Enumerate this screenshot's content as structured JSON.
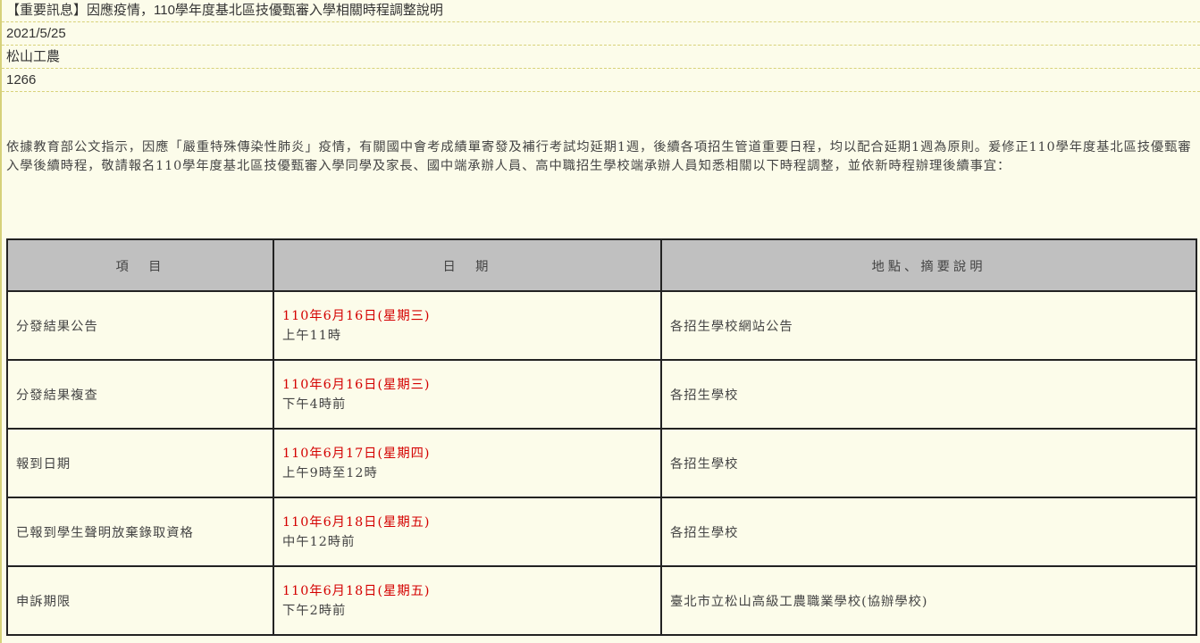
{
  "header": {
    "title": "【重要訊息】因應疫情，110學年度基北區技優甄審入學相關時程調整說明",
    "date": "2021/5/25",
    "publisher": "松山工農",
    "views": "1266"
  },
  "intro": "依據教育部公文指示，因應「嚴重特殊傳染性肺炎」疫情，有關國中會考成績單寄發及補行考試均延期1週，後續各項招生管道重要日程，均以配合延期1週為原則。爰修正110學年度基北區技優甄審入學後續時程，敬請報名110學年度基北區技優甄審入學同學及家長、國中端承辦人員、高中職招生學校端承辦人員知悉相關以下時程調整，並依新時程辦理後續事宜：",
  "table": {
    "headers": [
      "項　目",
      "日　期",
      "地點、摘要說明"
    ],
    "rows": [
      {
        "item": "分發結果公告",
        "date": "110年6月16日(星期三)",
        "time": "上午11時",
        "note": "各招生學校網站公告"
      },
      {
        "item": "分發結果複查",
        "date": "110年6月16日(星期三)",
        "time": "下午4時前",
        "note": "各招生學校"
      },
      {
        "item": "報到日期",
        "date": "110年6月17日(星期四)",
        "time": "上午9時至12時",
        "note": "各招生學校"
      },
      {
        "item": "已報到學生聲明放棄錄取資格",
        "date": "110年6月18日(星期五)",
        "time": "中午12時前",
        "note": "各招生學校"
      },
      {
        "item": "申訴期限",
        "date": "110年6月18日(星期五)",
        "time": "下午2時前",
        "note": "臺北市立松山高級工農職業學校(協辦學校)"
      }
    ]
  },
  "colors": {
    "background": "#fcfcea",
    "accent_date": "#d40000",
    "header_bg": "#c0c0c0",
    "dashed_border": "#d8d27a"
  }
}
